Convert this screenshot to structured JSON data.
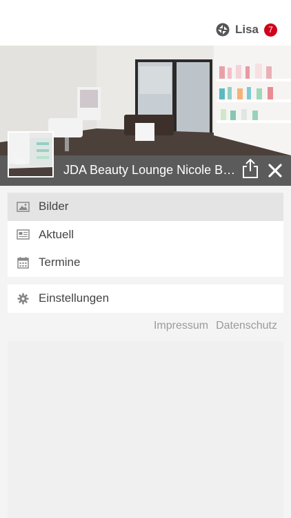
{
  "header": {
    "user_name": "Lisa",
    "notification_count": "7",
    "logo_icon": "app-logo-icon"
  },
  "hero": {
    "title": "JDA Beauty Lounge Nicole Be...",
    "share_icon": "share-icon",
    "close_icon": "close-icon"
  },
  "menu": {
    "items": [
      {
        "label": "Bilder",
        "icon": "image-icon",
        "active": true
      },
      {
        "label": "Aktuell",
        "icon": "news-icon",
        "active": false
      },
      {
        "label": "Termine",
        "icon": "calendar-icon",
        "active": false
      }
    ],
    "settings": {
      "label": "Einstellungen",
      "icon": "gear-icon"
    }
  },
  "footer": {
    "impressum": "Impressum",
    "datenschutz": "Datenschutz"
  },
  "colors": {
    "badge": "#d0021b",
    "hero_bar": "#464646",
    "active_item": "#e4e4e4"
  }
}
